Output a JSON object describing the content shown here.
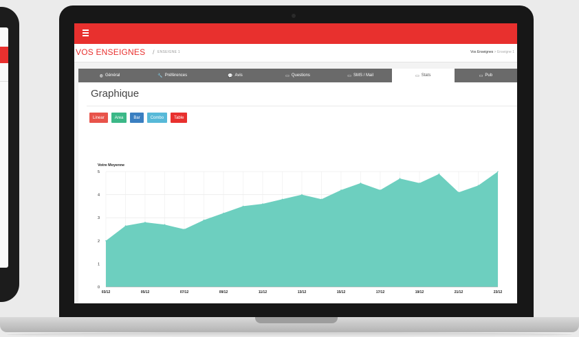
{
  "app": {
    "page_title": "VOS ENSEIGNES",
    "breadcrumb_separator": "/",
    "breadcrumb_current": "ENSEIGNE 1",
    "breadcrumb_right": {
      "link": "Vos Enseignes",
      "separator": ">",
      "current": "Enseigne 1"
    },
    "menu_icon": "hamburger-icon",
    "accent_color": "#e8302e"
  },
  "tabs": [
    {
      "label": "Général",
      "icon": "globe-icon",
      "glyph": "◍"
    },
    {
      "label": "Préférences",
      "icon": "wrench-icon",
      "glyph": "🔧"
    },
    {
      "label": "Avis",
      "icon": "comments-icon",
      "glyph": "💬"
    },
    {
      "label": "Questions",
      "icon": "laptop-icon",
      "glyph": "▭"
    },
    {
      "label": "SMS / Mail",
      "icon": "laptop-icon",
      "glyph": "▭"
    },
    {
      "label": "Stats",
      "icon": "laptop-icon",
      "glyph": "▭",
      "active": true
    },
    {
      "label": "Pub",
      "icon": "laptop-icon",
      "glyph": "▭"
    }
  ],
  "panel": {
    "title": "Graphique"
  },
  "chart_buttons": [
    {
      "label": "Linear",
      "color": "#e8534a"
    },
    {
      "label": "Area",
      "color": "#3bb887"
    },
    {
      "label": "Bar",
      "color": "#3a7fc1"
    },
    {
      "label": "Combo",
      "color": "#57b9d8"
    },
    {
      "label": "Table",
      "color": "#e8302e"
    }
  ],
  "chart_data": {
    "type": "area",
    "title": "Votre Moyenne",
    "color": "#6dcfbf",
    "ylim": [
      0,
      5
    ],
    "yticks": [
      0,
      1,
      2,
      3,
      4,
      5
    ],
    "grid": true,
    "x": [
      "03/12",
      "04/12",
      "05/12",
      "06/12",
      "07/12",
      "08/12",
      "09/12",
      "10/12",
      "11/12",
      "12/12",
      "13/12",
      "14/12",
      "15/12",
      "16/12",
      "17/12",
      "18/12",
      "19/12",
      "20/12",
      "21/12",
      "22/12",
      "23/12"
    ],
    "xtick_labels": [
      "03/12",
      "05/12",
      "07/12",
      "09/12",
      "11/12",
      "13/12",
      "15/12",
      "17/12",
      "19/12",
      "21/12",
      "23/12"
    ],
    "values": [
      2.0,
      2.65,
      2.8,
      2.7,
      2.5,
      2.9,
      3.2,
      3.5,
      3.6,
      3.8,
      4.0,
      3.8,
      4.2,
      4.5,
      4.2,
      4.7,
      4.5,
      4.9,
      4.1,
      4.4,
      5.0
    ]
  }
}
